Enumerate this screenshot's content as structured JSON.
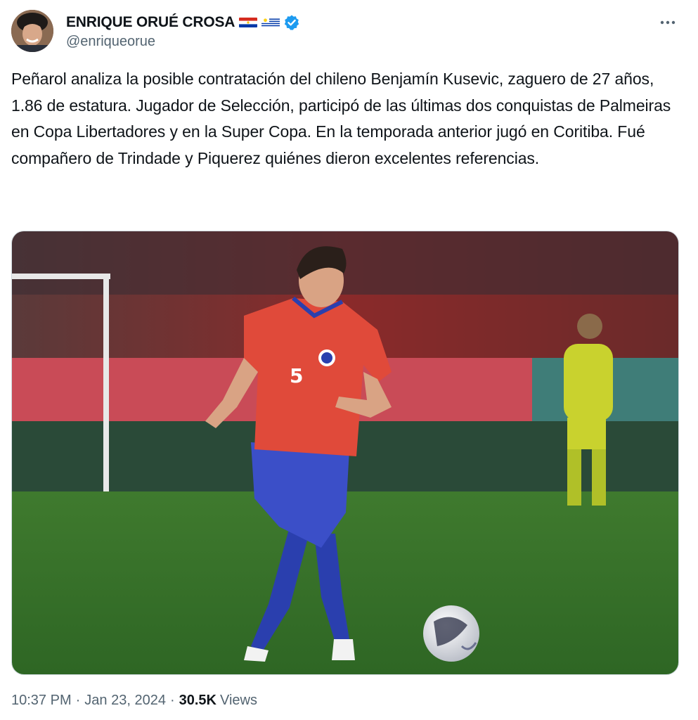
{
  "author": {
    "display_name": "ENRIQUE ORUÉ CROSA",
    "handle": "@enriqueorue",
    "flags": [
      "paraguay-flag",
      "uruguay-flag"
    ],
    "verified": true,
    "verified_color": "#1d9bf0"
  },
  "tweet": {
    "text": "Peñarol analiza la posible contratación del chileno Benjamín Kusevic, zaguero de 27 años, 1.86 de estatura. Jugador de Selección, participó de las últimas dos conquistas de Palmeiras en Copa Libertadores y en la Super Copa. En la temporada anterior jugó en Coritiba. Fué compañero de Trindade y Piquerez quiénes dieron excelentes referencias.",
    "time": "10:37 PM",
    "date": "Jan 23, 2024",
    "views_count": "30.5K",
    "views_label": "Views",
    "separator": "·"
  },
  "media": {
    "jersey_number": "5"
  },
  "colors": {
    "text": "#0f1419",
    "secondary": "#536471",
    "accent": "#1d9bf0"
  }
}
